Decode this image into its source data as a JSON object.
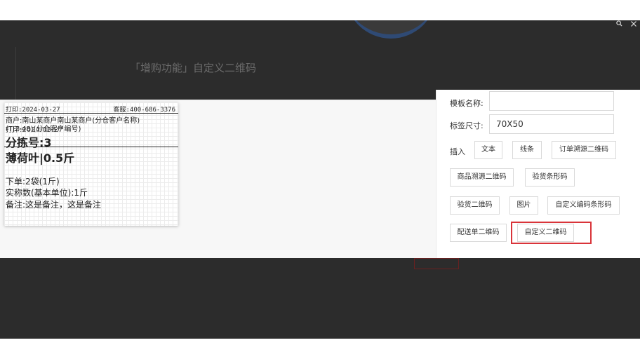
{
  "background": {
    "title": "「增购功能」自定义二维码",
    "window_controls": {
      "search_icon": "search-icon",
      "close_icon": "close-icon"
    }
  },
  "label_preview": {
    "print_date": "打印:2024-03-27",
    "service_phone": "客服:400-686-3376",
    "merchant": "商户:南山某商户南山某商户(分仓客户名称)",
    "overlap_a": "(TJ2-48)(分仓客户编号)",
    "overlap_b": "打印:2024-03-27",
    "sort_number": "分拣号:3",
    "product": "薄荷叶|0.5斤",
    "order_qty": "下单:2袋(1斤)",
    "actual_qty": "实称数(基本单位):1斤",
    "note": "备注:这是备注，这是备注"
  },
  "panel": {
    "template_name_label": "模板名称:",
    "template_name_value": "",
    "label_size_label": "标签尺寸:",
    "label_size_value": "70X50",
    "insert_label": "插入",
    "insert_buttons": {
      "text": "文本",
      "line": "线条",
      "order_trace_qr": "订单溯源二维码",
      "product_trace_qr": "商品溯源二维码",
      "inspection_barcode": "验货条形码",
      "inspection_qr": "验货二维码",
      "image": "图片",
      "custom_code_barcode": "自定义编码条形码",
      "delivery_qr": "配送单二维码",
      "custom_qr": "自定义二维码"
    }
  },
  "colors": {
    "highlight": "#d9343a",
    "overlay": "#2c2c2c"
  }
}
